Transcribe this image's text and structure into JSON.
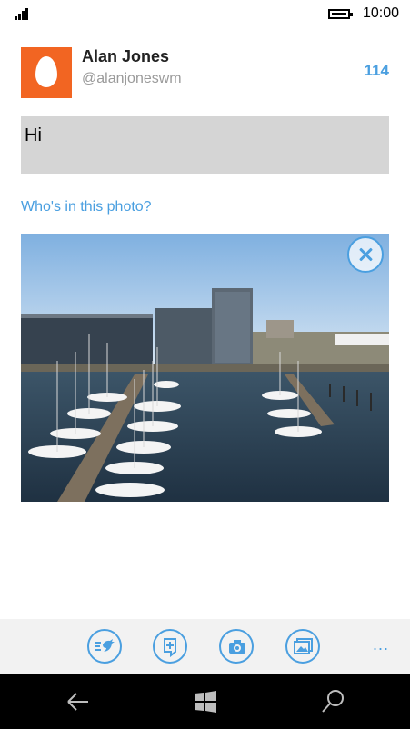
{
  "status": {
    "time": "10:00",
    "icons": [
      "signal-icon",
      "battery-icon"
    ]
  },
  "user": {
    "name": "Alan Jones",
    "handle": "@alanjoneswm",
    "char_count": "114"
  },
  "compose": {
    "text": "Hi"
  },
  "photo": {
    "tag_prompt": "Who's in this photo?",
    "remove_icon": "close-icon"
  },
  "app_bar": {
    "buttons": [
      "tweet-icon",
      "draft-icon",
      "camera-icon",
      "gallery-icon"
    ],
    "more": "..."
  },
  "nav": {
    "buttons": [
      "back-icon",
      "windows-icon",
      "search-icon"
    ]
  },
  "colors": {
    "accent": "#4a9fe0",
    "avatar": "#f26522",
    "compose_bg": "#d5d5d5",
    "app_bar_bg": "#f2f2f2",
    "nav_bg": "#000000"
  }
}
